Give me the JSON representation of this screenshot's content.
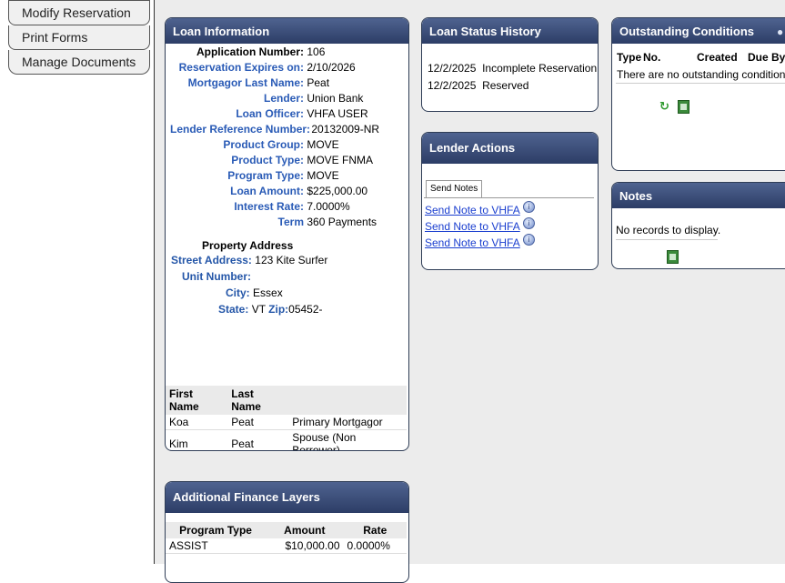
{
  "sidebar": {
    "items": [
      {
        "label": "Modify Reservation"
      },
      {
        "label": "Print Forms"
      },
      {
        "label": "Manage Documents"
      }
    ]
  },
  "loan_info": {
    "title": "Loan Information",
    "fields": [
      {
        "label": "Application Number:",
        "value": "106"
      },
      {
        "label": "Reservation Expires on:",
        "value": "2/10/2026"
      },
      {
        "label": "Mortgagor Last Name:",
        "value": "Peat"
      },
      {
        "label": "Lender:",
        "value": "Union Bank"
      },
      {
        "label": "Loan Officer:",
        "value": "VHFA USER"
      },
      {
        "label": "Lender Reference Number:",
        "value": "20132009-NR"
      },
      {
        "label": "Product Group:",
        "value": "MOVE"
      },
      {
        "label": "Product Type:",
        "value": "MOVE FNMA"
      },
      {
        "label": "Program Type:",
        "value": "MOVE"
      },
      {
        "label": "Loan Amount:",
        "value": "$225,000.00"
      },
      {
        "label": "Interest Rate:",
        "value": "7.0000%"
      },
      {
        "label": "Term",
        "value": "360 Payments"
      }
    ],
    "property_heading": "Property Address",
    "street_label": "Street Address:",
    "street_value": "123 Kite Surfer",
    "unit_label": "Unit Number:",
    "unit_value": "",
    "city_label": "City:",
    "city_value": "Essex",
    "state_label": "State:",
    "state_value": "VT",
    "zip_label": "Zip:",
    "zip_value": "05452-",
    "borrowers_headers": [
      "First Name",
      "Last Name",
      ""
    ],
    "borrowers": [
      [
        "Koa",
        "Peat",
        "Primary Mortgagor"
      ],
      [
        "Kim",
        "Peat",
        "Spouse (Non Borrower)"
      ]
    ]
  },
  "status_history": {
    "title": "Loan Status History",
    "rows": [
      {
        "date": "12/2/2025",
        "status": "Incomplete Reservation"
      },
      {
        "date": "12/2/2025",
        "status": "Reserved"
      }
    ]
  },
  "lender_actions": {
    "title": "Lender Actions",
    "tab": "Send Notes",
    "links": [
      "Send Note to VHFA",
      "Send Note to VHFA",
      "Send Note to VHFA"
    ]
  },
  "conditions": {
    "title": "Outstanding Conditions",
    "headers": [
      "Type",
      "No.",
      "Created",
      "Due By"
    ],
    "empty_text": "There are no outstanding conditions."
  },
  "notes": {
    "title": "Notes",
    "empty_text": "No records to display."
  },
  "finance_layers": {
    "title": "Additional Finance Layers",
    "headers": [
      "Program Type",
      "Amount",
      "Rate"
    ],
    "rows": [
      [
        "ASSIST",
        "$10,000.00",
        "0.0000%"
      ]
    ]
  }
}
